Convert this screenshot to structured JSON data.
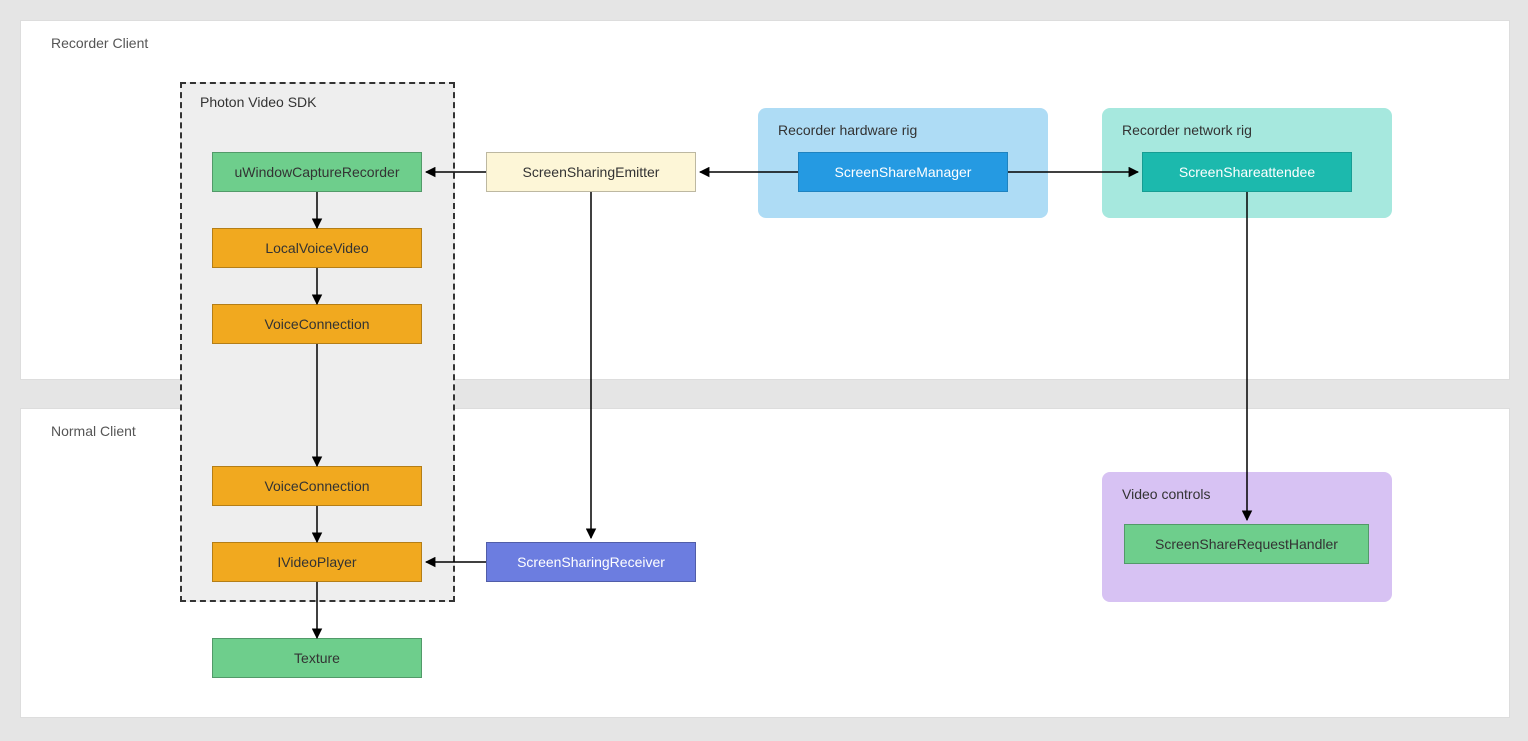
{
  "panels": {
    "recorder_client": "Recorder Client",
    "normal_client": "Normal Client"
  },
  "groups": {
    "photon_sdk": "Photon Video SDK",
    "hardware_rig": "Recorder hardware rig",
    "network_rig": "Recorder network rig",
    "video_controls": "Video controls"
  },
  "nodes": {
    "uwindow": "uWindowCaptureRecorder",
    "localvoice": "LocalVoiceVideo",
    "voiceconn1": "VoiceConnection",
    "voiceconn2": "VoiceConnection",
    "ivideoplayer": "IVideoPlayer",
    "texture": "Texture",
    "emitter": "ScreenSharingEmitter",
    "receiver": "ScreenSharingReceiver",
    "manager": "ScreenShareManager",
    "attendee": "ScreenShareattendee",
    "handler": "ScreenShareRequestHandler"
  }
}
